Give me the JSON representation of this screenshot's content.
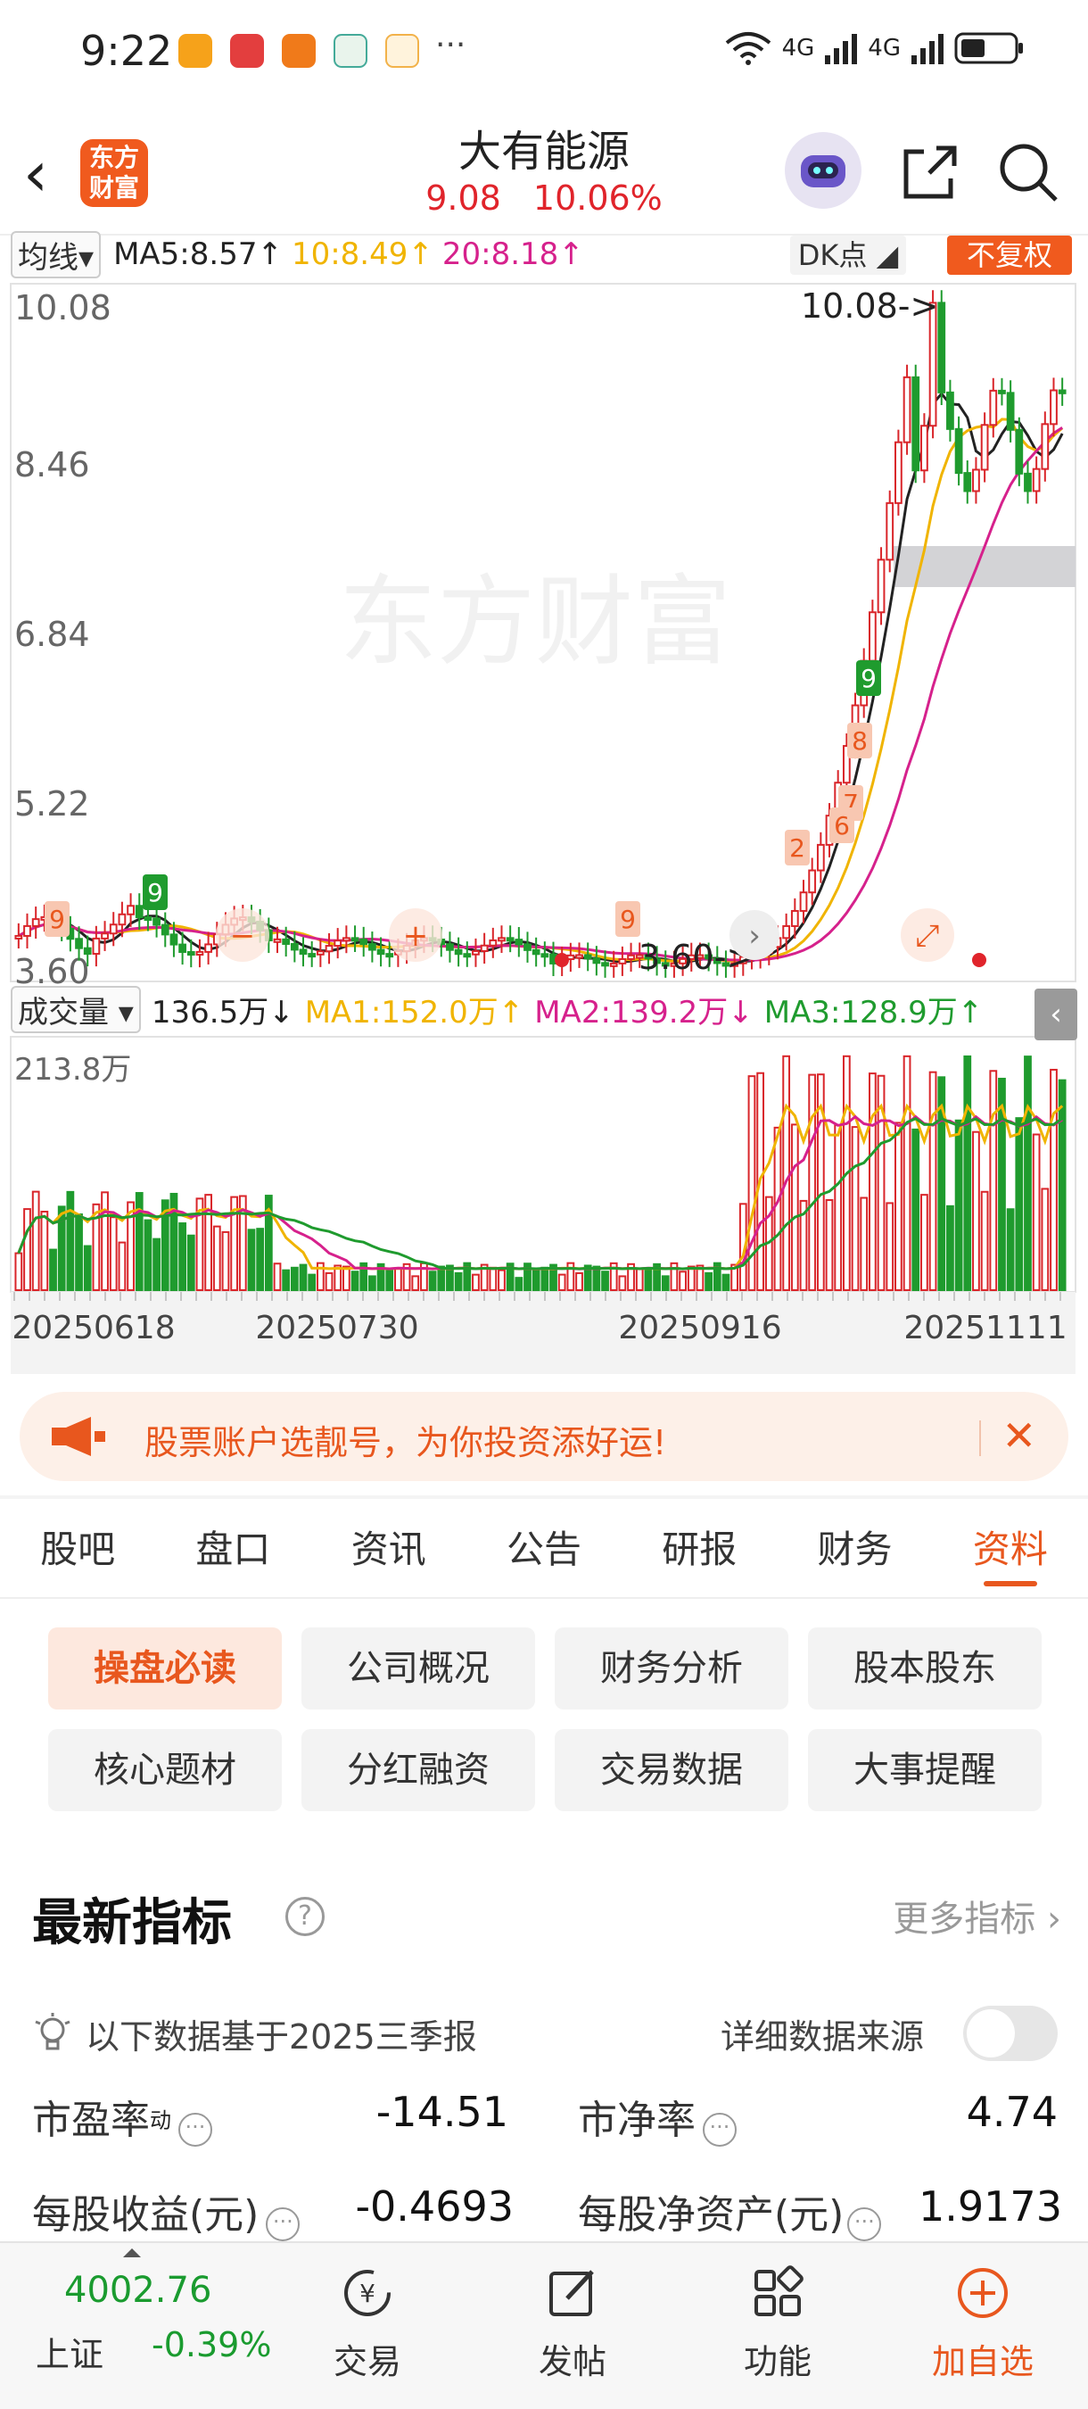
{
  "status_bar": {
    "time": "9:22",
    "more": "···",
    "net1": "4G",
    "net2": "4G"
  },
  "header": {
    "title": "大有能源",
    "price": "9.08",
    "change_pct": "10.06%"
  },
  "logo_text": "东方财富",
  "kline_bar": {
    "type_label": "均线",
    "ma5": "MA5:8.57↑",
    "ma10": "10:8.49↑",
    "ma20": "20:8.18↑",
    "dk_label": "DK点",
    "fuquan_label": "不复权"
  },
  "colors": {
    "up": "#d9252a",
    "down": "#1f9b2e",
    "ma5": "#222222",
    "ma10": "#f0b400",
    "ma20": "#d6218c",
    "accent": "#f05a1e"
  },
  "price_axis": {
    "ticks": [
      "10.08",
      "8.46",
      "6.84",
      "5.22",
      "3.60"
    ],
    "high_label": "10.08->",
    "low_label": "3.60->"
  },
  "watermark": "东方财富",
  "volume_bar": {
    "type_label": "成交量",
    "vol": "136.5万↓",
    "ma1": "MA1:152.0万↑",
    "ma2": "MA2:139.2万↓",
    "ma3": "MA3:128.9万↑",
    "max_label": "213.8万"
  },
  "date_axis": [
    "20250618",
    "20250730",
    "20250916",
    "20251111"
  ],
  "chart_data": {
    "type": "candlestick",
    "y_range": [
      3.6,
      10.08
    ],
    "last_close": 9.08,
    "ma": {
      "MA5": 8.57,
      "MA10": 8.49,
      "MA20": 8.18
    },
    "volume": {
      "last": "136.5万",
      "MA1": "152.0万",
      "MA2": "139.2万",
      "MA3": "128.9万",
      "max": "213.8万"
    },
    "dates": [
      "20250618",
      "20250730",
      "20250916",
      "20251111"
    ]
  },
  "banner": {
    "text": "股票账户选靓号，为你投资添好运!"
  },
  "tabs": [
    "股吧",
    "盘口",
    "资讯",
    "公告",
    "研报",
    "财务",
    "资料"
  ],
  "grid_buttons": [
    "操盘必读",
    "公司概况",
    "财务分析",
    "股本股东",
    "核心题材",
    "分红融资",
    "交易数据",
    "大事提醒"
  ],
  "section": {
    "title": "最新指标",
    "more": "更多指标 ›",
    "basis": "以下数据基于2025三季报",
    "source": "详细数据来源"
  },
  "metrics": [
    {
      "label": "市盈率",
      "sup": "动",
      "value": "-14.51"
    },
    {
      "label": "市净率",
      "sup": "",
      "value": "4.74"
    },
    {
      "label": "每股收益(元)",
      "sup": "",
      "value": "-0.4693"
    },
    {
      "label": "每股净资产(元)",
      "sup": "",
      "value": "1.9173"
    }
  ],
  "bottom_nav": {
    "index_value": "4002.76",
    "index_name": "上证",
    "index_change": "-0.39%",
    "items": [
      "交易",
      "发帖",
      "功能",
      "加自选"
    ]
  }
}
